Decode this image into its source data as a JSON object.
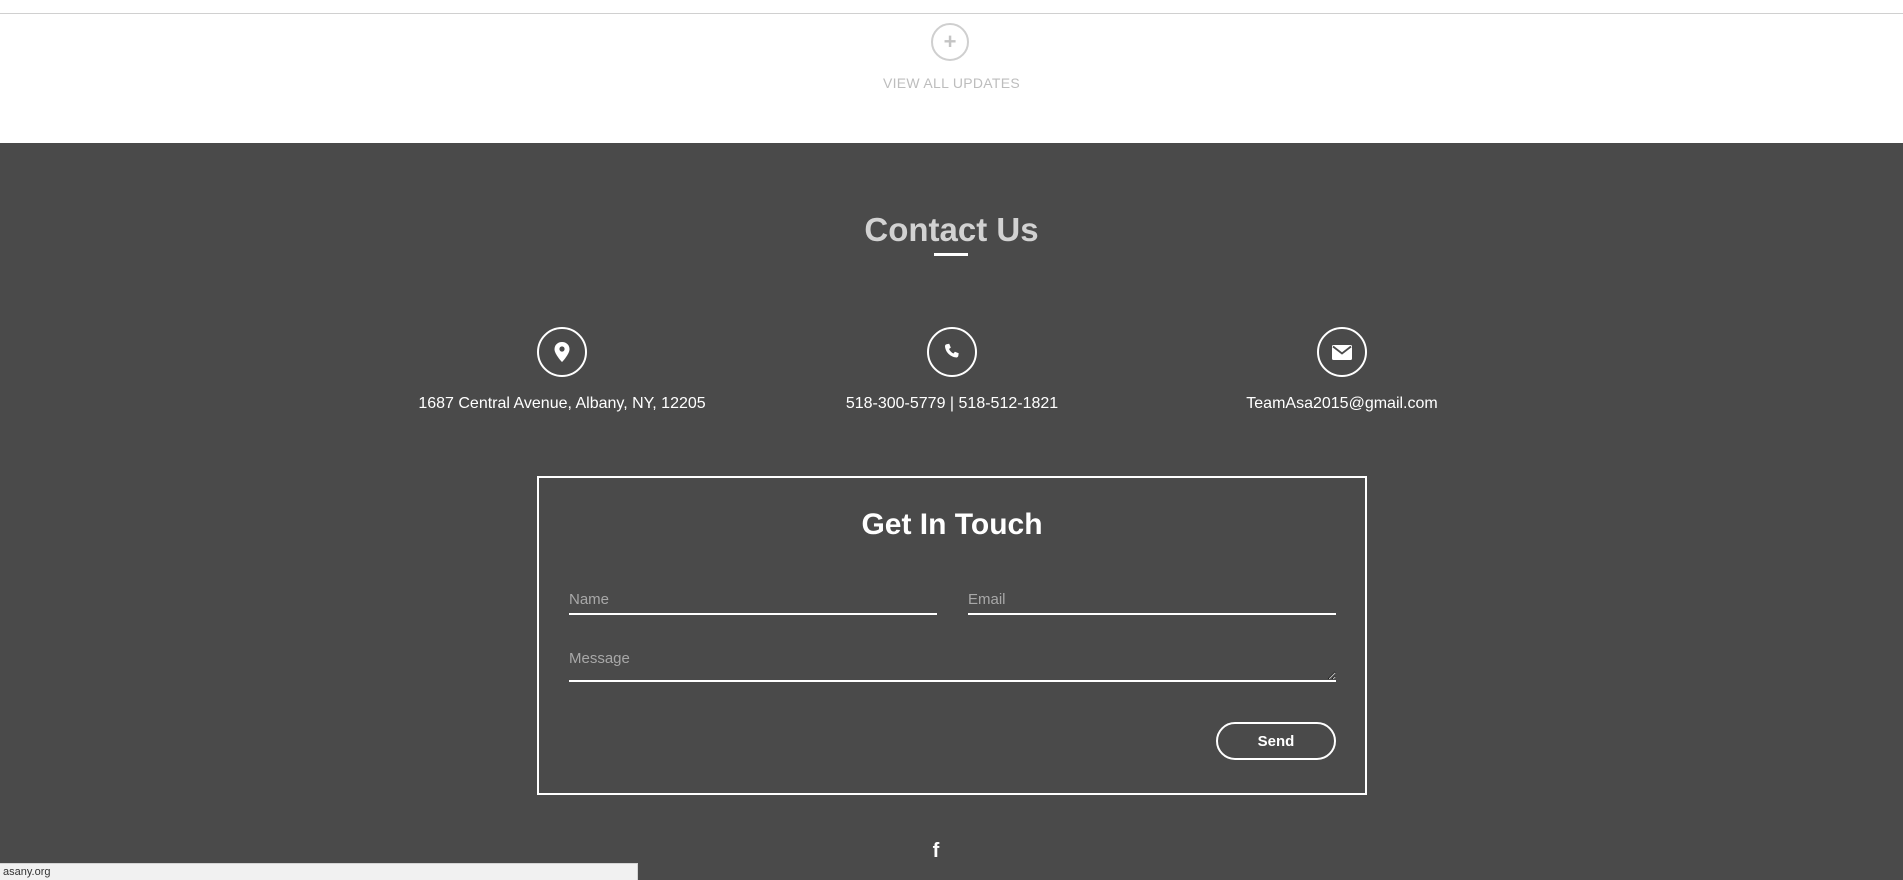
{
  "updates": {
    "plus_glyph": "+",
    "view_all_label": "VIEW ALL UPDATES"
  },
  "contact": {
    "title": "Contact Us",
    "address": "1687 Central Avenue, Albany, NY, 12205",
    "phones": "518-300-5779 | 518-512-1821",
    "email": "TeamAsa2015@gmail.com",
    "icons": {
      "address": "map-pin-icon",
      "phone": "phone-icon",
      "email": "envelope-icon"
    }
  },
  "form": {
    "title": "Get In Touch",
    "name_placeholder": "Name",
    "email_placeholder": "Email",
    "message_placeholder": "Message",
    "send_label": "Send"
  },
  "social": {
    "facebook_glyph": "f",
    "facebook_icon": "facebook-icon"
  },
  "status_bar": {
    "url": "asany.org"
  },
  "colors": {
    "section_bg": "#4a4a4a",
    "title_color": "#d2d2d2",
    "muted_gray": "#bdbdbd"
  }
}
